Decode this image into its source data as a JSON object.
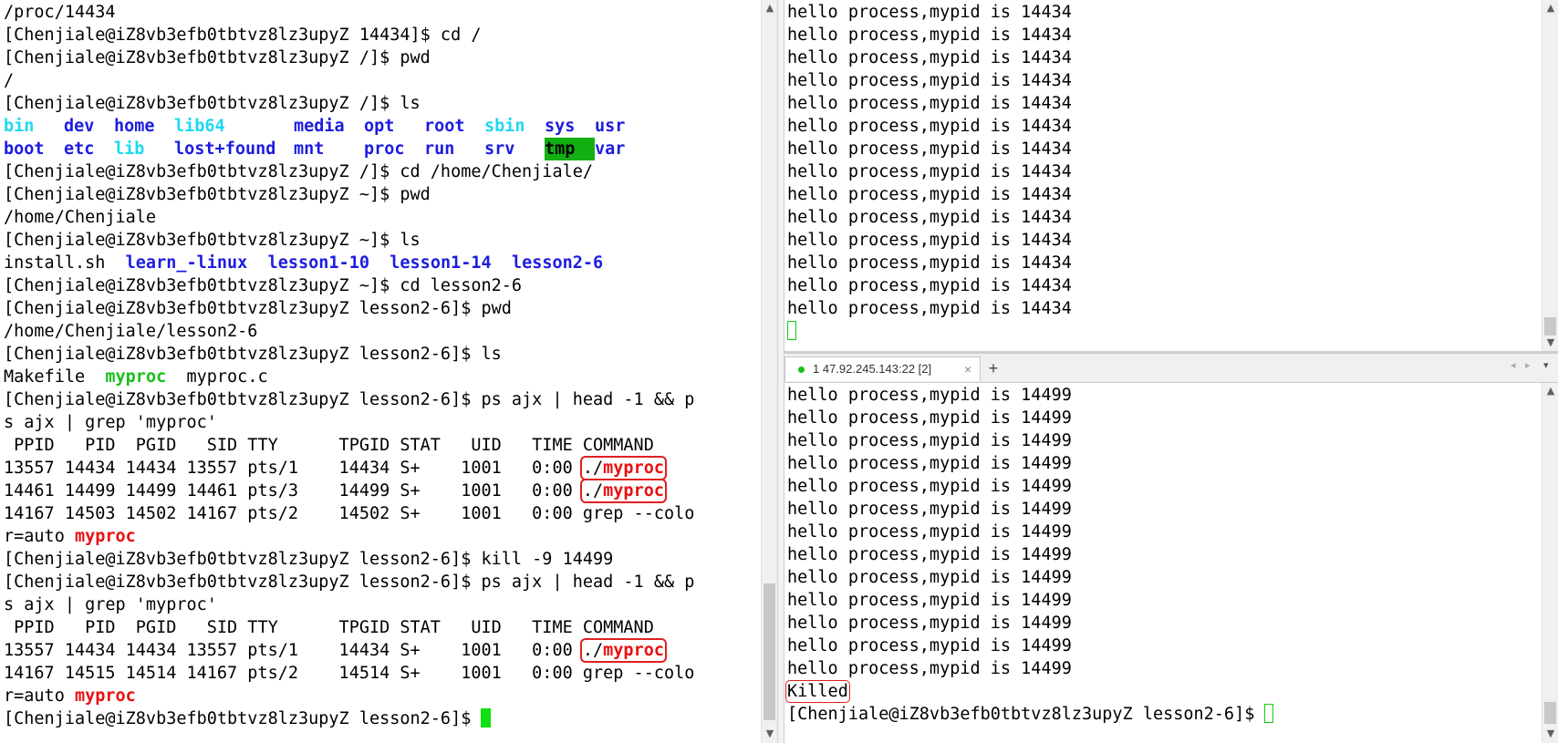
{
  "left_terminal": {
    "lines": [
      {
        "t": "/proc/14434"
      },
      {
        "t": "[Chenjiale@iZ8vb3efb0tbtvz8lz3upyZ 14434]$ cd /"
      },
      {
        "t": "[Chenjiale@iZ8vb3efb0tbtvz8lz3upyZ /]$ pwd"
      },
      {
        "t": "/"
      },
      {
        "t": "[Chenjiale@iZ8vb3efb0tbtvz8lz3upyZ /]$ ls"
      },
      {
        "ls": [
          {
            "t": "bin",
            "c": "cyan"
          },
          {
            "t": "dev",
            "c": "blue"
          },
          {
            "t": "home",
            "c": "blue"
          },
          {
            "t": "lib64",
            "c": "cyan"
          },
          {
            "t": "media",
            "c": "blue"
          },
          {
            "t": "opt",
            "c": "blue"
          },
          {
            "t": "root",
            "c": "blue"
          },
          {
            "t": "sbin",
            "c": "cyan"
          },
          {
            "t": "sys",
            "c": "blue"
          },
          {
            "t": "usr",
            "c": "blue"
          }
        ]
      },
      {
        "ls": [
          {
            "t": "boot",
            "c": "blue"
          },
          {
            "t": "etc",
            "c": "blue"
          },
          {
            "t": "lib",
            "c": "cyan"
          },
          {
            "t": "lost+found",
            "c": "blue"
          },
          {
            "t": "mnt",
            "c": "blue"
          },
          {
            "t": "proc",
            "c": "blue"
          },
          {
            "t": "run",
            "c": "blue"
          },
          {
            "t": "srv",
            "c": "blue"
          },
          {
            "t": "tmp",
            "c": "tmp"
          },
          {
            "t": "var",
            "c": "blue"
          }
        ]
      },
      {
        "t": "[Chenjiale@iZ8vb3efb0tbtvz8lz3upyZ /]$ cd /home/Chenjiale/"
      },
      {
        "t": "[Chenjiale@iZ8vb3efb0tbtvz8lz3upyZ ~]$ pwd"
      },
      {
        "t": "/home/Chenjiale"
      },
      {
        "t": "[Chenjiale@iZ8vb3efb0tbtvz8lz3upyZ ~]$ ls"
      },
      {
        "parts": [
          {
            "t": "install.sh  "
          },
          {
            "t": "learn_-linux",
            "c": "blue"
          },
          {
            "t": "  "
          },
          {
            "t": "lesson1-10",
            "c": "blue"
          },
          {
            "t": "  "
          },
          {
            "t": "lesson1-14",
            "c": "blue"
          },
          {
            "t": "  "
          },
          {
            "t": "lesson2-6",
            "c": "blue"
          }
        ]
      },
      {
        "t": "[Chenjiale@iZ8vb3efb0tbtvz8lz3upyZ ~]$ cd lesson2-6"
      },
      {
        "t": "[Chenjiale@iZ8vb3efb0tbtvz8lz3upyZ lesson2-6]$ pwd"
      },
      {
        "t": "/home/Chenjiale/lesson2-6"
      },
      {
        "t": "[Chenjiale@iZ8vb3efb0tbtvz8lz3upyZ lesson2-6]$ ls"
      },
      {
        "parts": [
          {
            "t": "Makefile  "
          },
          {
            "t": "myproc",
            "c": "green"
          },
          {
            "t": "  myproc.c"
          }
        ]
      },
      {
        "t": "[Chenjiale@iZ8vb3efb0tbtvz8lz3upyZ lesson2-6]$ ps ajx | head -1 && p"
      },
      {
        "t": "s ajx | grep 'myproc'"
      },
      {
        "t": " PPID   PID  PGID   SID TTY      TPGID STAT   UID   TIME COMMAND"
      },
      {
        "parts": [
          {
            "t": "13557 14434 14434 13557 pts/1    14434 S+    1001   0:00 "
          },
          {
            "t": "./",
            "box": "a"
          },
          {
            "t": "myproc",
            "c": "red",
            "box": "a"
          }
        ]
      },
      {
        "parts": [
          {
            "t": "14461 14499 14499 14461 pts/3    14499 S+    1001   0:00 "
          },
          {
            "t": "./",
            "box": "a"
          },
          {
            "t": "myproc",
            "c": "red",
            "box": "a"
          }
        ]
      },
      {
        "t": "14167 14503 14502 14167 pts/2    14502 S+    1001   0:00 grep --colo"
      },
      {
        "parts": [
          {
            "t": "r=auto "
          },
          {
            "t": "myproc",
            "c": "red"
          }
        ]
      },
      {
        "t": "[Chenjiale@iZ8vb3efb0tbtvz8lz3upyZ lesson2-6]$ kill -9 14499"
      },
      {
        "t": "[Chenjiale@iZ8vb3efb0tbtvz8lz3upyZ lesson2-6]$ ps ajx | head -1 && p"
      },
      {
        "t": "s ajx | grep 'myproc'"
      },
      {
        "t": " PPID   PID  PGID   SID TTY      TPGID STAT   UID   TIME COMMAND"
      },
      {
        "parts": [
          {
            "t": "13557 14434 14434 13557 pts/1    14434 S+    1001   0:00 "
          },
          {
            "t": "./",
            "box": "b"
          },
          {
            "t": "myproc",
            "c": "red",
            "box": "b"
          }
        ]
      },
      {
        "t": "14167 14515 14514 14167 pts/2    14514 S+    1001   0:00 grep --colo"
      },
      {
        "parts": [
          {
            "t": "r=auto "
          },
          {
            "t": "myproc",
            "c": "red"
          }
        ]
      },
      {
        "prompt": "[Chenjiale@iZ8vb3efb0tbtvz8lz3upyZ lesson2-6]$ ",
        "cursor": "block"
      }
    ]
  },
  "right_top_terminal": {
    "repeat_line": "hello process,mypid is 14434",
    "repeat_count": 14,
    "cursor": "hollow"
  },
  "tab": {
    "label": "1 47.92.245.143:22 [2]",
    "close": "×",
    "add": "+"
  },
  "right_bottom_terminal": {
    "repeat_line": "hello process,mypid is 14499",
    "repeat_count": 13,
    "killed": "Killed",
    "prompt": "[Chenjiale@iZ8vb3efb0tbtvz8lz3upyZ lesson2-6]$ "
  },
  "colors": {
    "cyan": "#1ed8f0",
    "blue": "#1c1ce0",
    "green": "#18c018",
    "red": "#e81010",
    "cursor": "#10e010"
  },
  "icons": {
    "scroll_up": "▲",
    "scroll_down": "▼",
    "tab_status": "green-dot"
  }
}
